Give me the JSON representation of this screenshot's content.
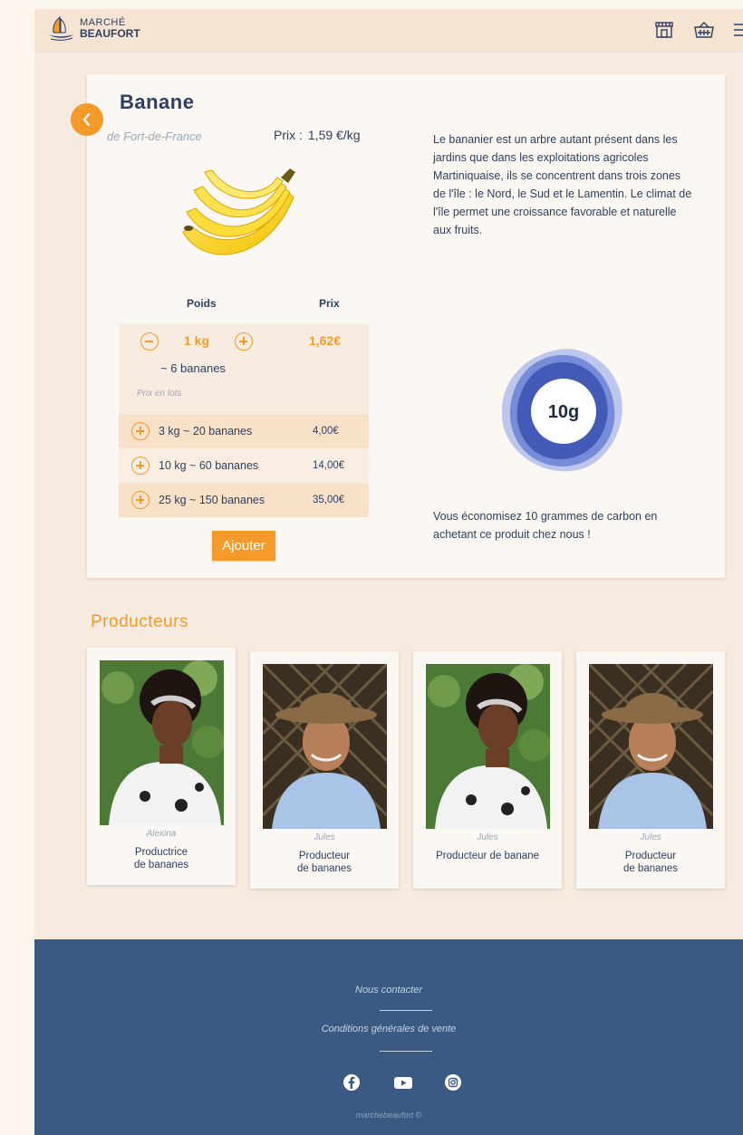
{
  "header": {
    "logo_line1": "MARCHÉ",
    "logo_line2": "BEAUFORT",
    "icons": [
      "shop-icon",
      "basket-icon",
      "menu-icon"
    ]
  },
  "product": {
    "name": "Banane",
    "origin": "de Fort-de-France",
    "price_label": "Prix :",
    "price_value": "1,59 €/kg",
    "description": "Le bananier est un arbre autant présent dans les jardins que dans les exploitations agricoles Martiniquaise, ils se concentrent dans trois zones de l'île : le Nord, le Sud et le Lamentin. Le climat de l'île permet une croissance favorable et naturelle aux fruits.",
    "table": {
      "weight_header": "Poids",
      "price_header": "Prix",
      "quantity": "1 kg",
      "quantity_price": "1,62€",
      "approx": "~ 6 bananes",
      "lots_label": "Prix en lots",
      "lots": [
        {
          "label": "3 kg ~ 20 bananes",
          "price": "4,00€"
        },
        {
          "label": "10 kg ~ 60 bananes",
          "price": "14,00€"
        },
        {
          "label": "25 kg ~ 150 bananes",
          "price": "35,00€"
        }
      ]
    },
    "add_label": "Ajouter",
    "carbon_value": "10g",
    "carbon_text": "Vous économisez 10 grammes de carbon en achetant ce produit chez nous !"
  },
  "producers": {
    "title": "Producteurs",
    "items": [
      {
        "name": "Alexina",
        "role_line1": "Productrice",
        "role_line2": "de bananes"
      },
      {
        "name": "Jules",
        "role_line1": "Producteur",
        "role_line2": "de bananes"
      },
      {
        "name": "Jules",
        "role_line1": "Producteur de banane",
        "role_line2": ""
      },
      {
        "name": "Jules",
        "role_line1": "Producteur",
        "role_line2": "de bananes"
      }
    ]
  },
  "footer": {
    "contact": "Nous contacter",
    "cgv": "Conditions générales de vente",
    "social": [
      "facebook-icon",
      "youtube-icon",
      "instagram-icon"
    ],
    "copyright": "marchebeaufort ©"
  },
  "colors": {
    "accent": "#f39a2b",
    "navy": "#2d3f63",
    "footer": "#3a5a83"
  }
}
